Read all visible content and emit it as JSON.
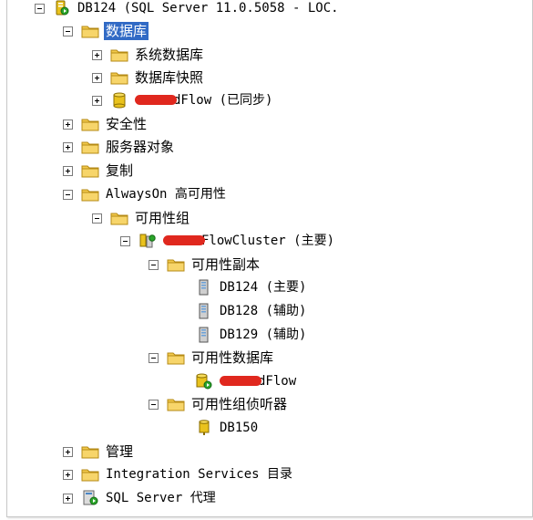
{
  "tree": {
    "server": {
      "label": "DB124 (SQL Server 11.0.5058 - LOC."
    },
    "databases": {
      "label": "数据库",
      "system_databases": "系统数据库",
      "snapshots": "数据库快照",
      "db_workflow_suffix": "dFlow (已同步)"
    },
    "security": "安全性",
    "server_objects": "服务器对象",
    "replication": "复制",
    "alwayson": {
      "label": "AlwaysOn 高可用性",
      "groups": {
        "label": "可用性组",
        "cluster_suffix": "FlowCluster (主要)",
        "replicas": {
          "label": "可用性副本",
          "items": [
            "DB124 (主要)",
            "DB128 (辅助)",
            "DB129 (辅助)"
          ]
        },
        "avail_databases": {
          "label": "可用性数据库",
          "db_suffix": "dFlow"
        },
        "listeners": {
          "label": "可用性组侦听器",
          "items": [
            "DB150"
          ]
        }
      }
    },
    "management": "管理",
    "integration_services": "Integration Services 目录",
    "sql_agent": "SQL Server 代理"
  },
  "colors": {
    "selection": "#316ac5",
    "folder": "#f2c94c",
    "redaction": "#e0281e"
  },
  "icons": {
    "folder": "folder-icon",
    "database": "database-icon",
    "server": "server-icon",
    "availability_group": "availability-group-icon",
    "replica": "replica-server-icon",
    "listener": "listener-icon",
    "agent": "sql-agent-icon"
  }
}
